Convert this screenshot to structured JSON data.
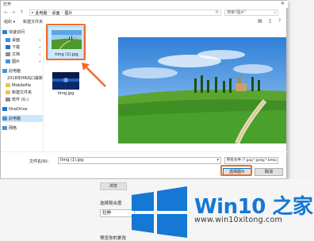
{
  "window": {
    "title": "打开",
    "close_glyph": "✕"
  },
  "nav": {
    "back": "←",
    "forward": "→",
    "up": "↑",
    "breadcrumbs": [
      "此电脑",
      "桌面",
      "图片"
    ],
    "search_placeholder": "搜索\"图片\""
  },
  "toolbar": {
    "organize": "组织 ▾",
    "new_folder": "新建文件夹"
  },
  "sidebar": {
    "items": [
      {
        "label": "快速访问",
        "icon": "star-icon",
        "color": "#2d7fd6"
      },
      {
        "label": "桌面",
        "icon": "desktop-icon",
        "color": "#3a8ee6"
      },
      {
        "label": "下载",
        "icon": "download-icon",
        "color": "#2b6cc4"
      },
      {
        "label": "文档",
        "icon": "document-icon",
        "color": "#8d8d8d"
      },
      {
        "label": "图片",
        "icon": "picture-icon",
        "color": "#4a90d9"
      },
      {
        "label": "此电脑",
        "icon": "computer-icon",
        "color": "#4a90d9"
      },
      {
        "label": "2018年HR出口最新",
        "icon": "folder-icon",
        "color": "#e8c35a"
      },
      {
        "label": "Mobilefile",
        "icon": "folder-icon",
        "color": "#e8c35a"
      },
      {
        "label": "新建文件夹",
        "icon": "folder-icon",
        "color": "#e8c35a"
      },
      {
        "label": "软件 (G:)",
        "icon": "drive-icon",
        "color": "#8d8d8d"
      },
      {
        "label": "OneDrive",
        "icon": "cloud-icon",
        "color": "#1e73d2"
      },
      {
        "label": "此电脑",
        "icon": "computer-icon",
        "color": "#4a90d9"
      },
      {
        "label": "网络",
        "icon": "network-icon",
        "color": "#4a90d9"
      }
    ]
  },
  "files": [
    {
      "name": "timg (1).jpg",
      "selected": true
    },
    {
      "name": "timg.jpg",
      "selected": false
    }
  ],
  "bottom": {
    "filename_label": "文件名(N):",
    "filename_value": "timg (1).jpg",
    "filetype": "所有文件 (*.jpg;*.jpeg;*.bmp;*",
    "open_button": "选择图片",
    "cancel_button": "取消"
  },
  "background": {
    "browse_button": "浏览",
    "fit_label": "选择契合度",
    "fit_value": "拉伸",
    "bottom_label": "预览你的更改"
  },
  "watermark": {
    "title": "Win10 之家",
    "url": "www.win10xitong.com"
  },
  "colors": {
    "accent": "#0078d7",
    "highlight": "#f06a2b",
    "win_blue": "#1478d4"
  }
}
